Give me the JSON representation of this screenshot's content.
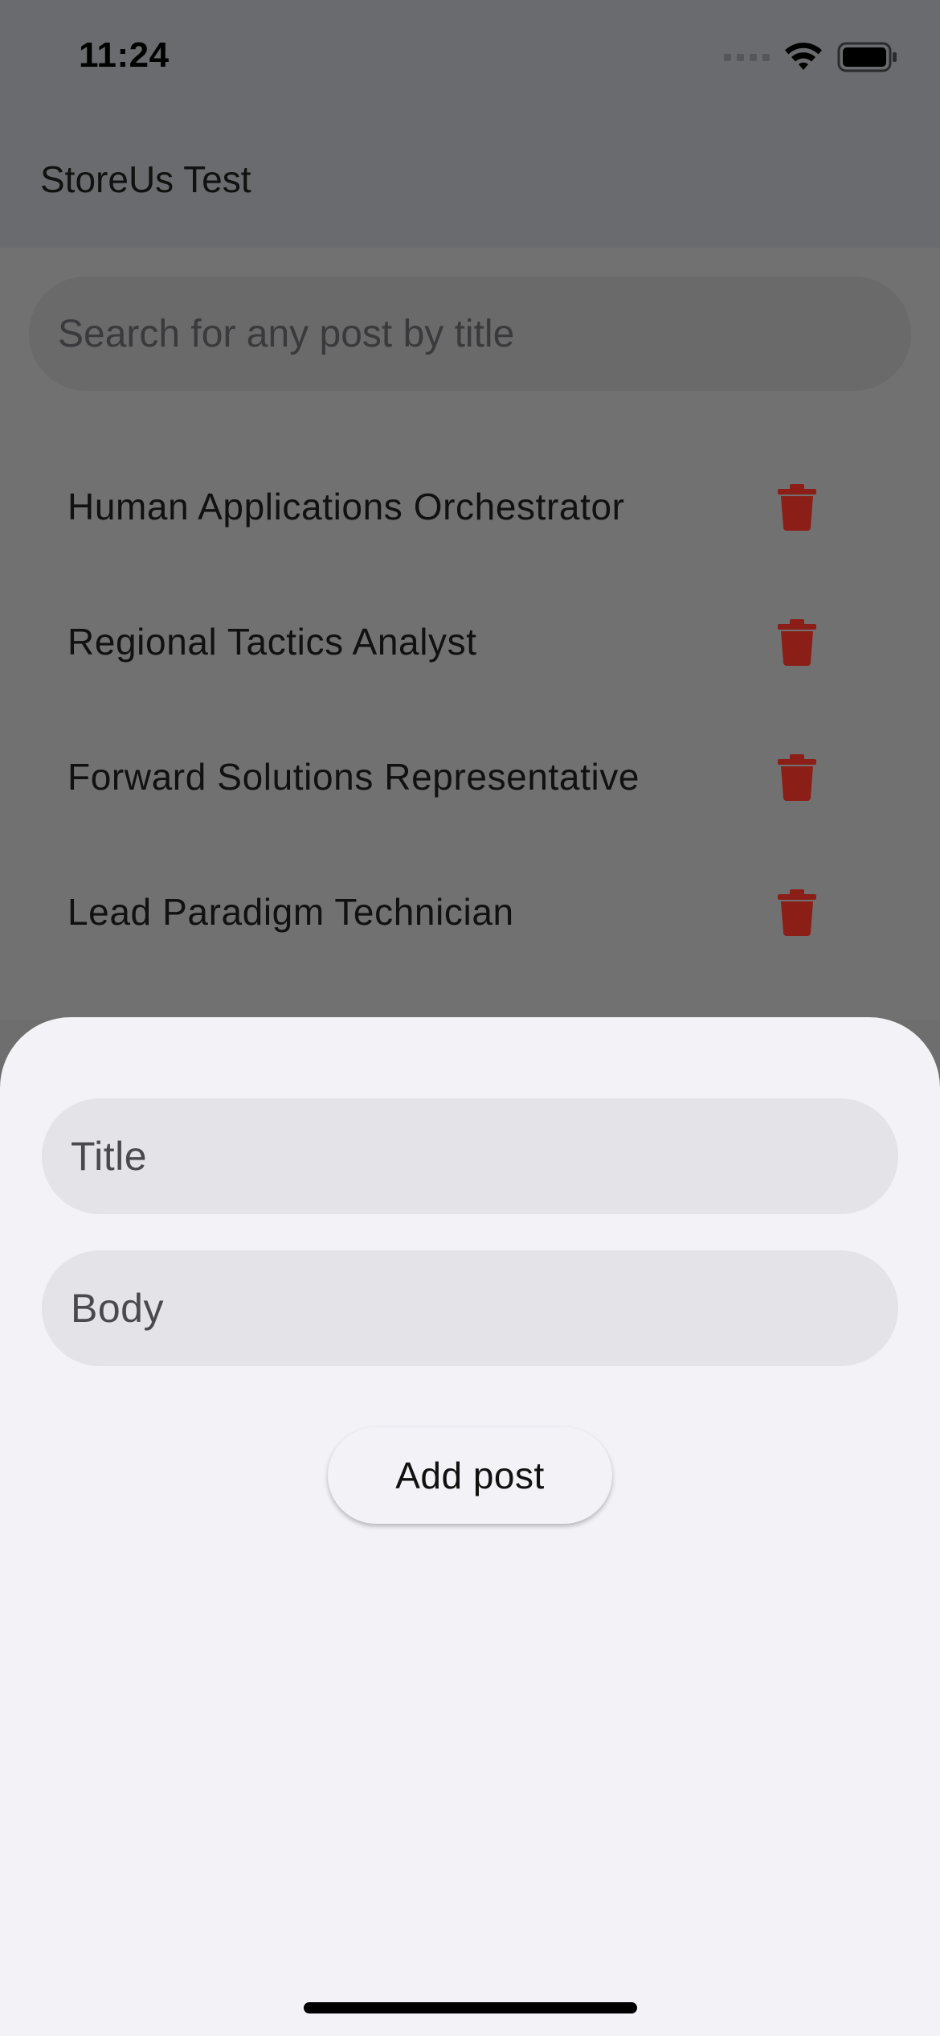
{
  "status_bar": {
    "time": "11:24",
    "icons": [
      "cellular-signal-icon",
      "wifi-icon",
      "battery-icon"
    ]
  },
  "app_bar": {
    "title": "StoreUs Test"
  },
  "search": {
    "placeholder": "Search for any post by title"
  },
  "posts": [
    {
      "title": "Human Applications Orchestrator",
      "action_icon": "trash-icon"
    },
    {
      "title": "Regional Tactics Analyst",
      "action_icon": "trash-icon"
    },
    {
      "title": "Forward Solutions Representative",
      "action_icon": "trash-icon"
    },
    {
      "title": "Lead Paradigm Technician",
      "action_icon": "trash-icon"
    }
  ],
  "sheet": {
    "title_placeholder": "Title",
    "body_placeholder": "Body",
    "add_button_label": "Add post"
  },
  "colors": {
    "delete_icon": "#8b1f18",
    "sheet_background": "#f2f2f7",
    "field_background": "#e3e3e8",
    "scrim": "#6e6e6f"
  }
}
